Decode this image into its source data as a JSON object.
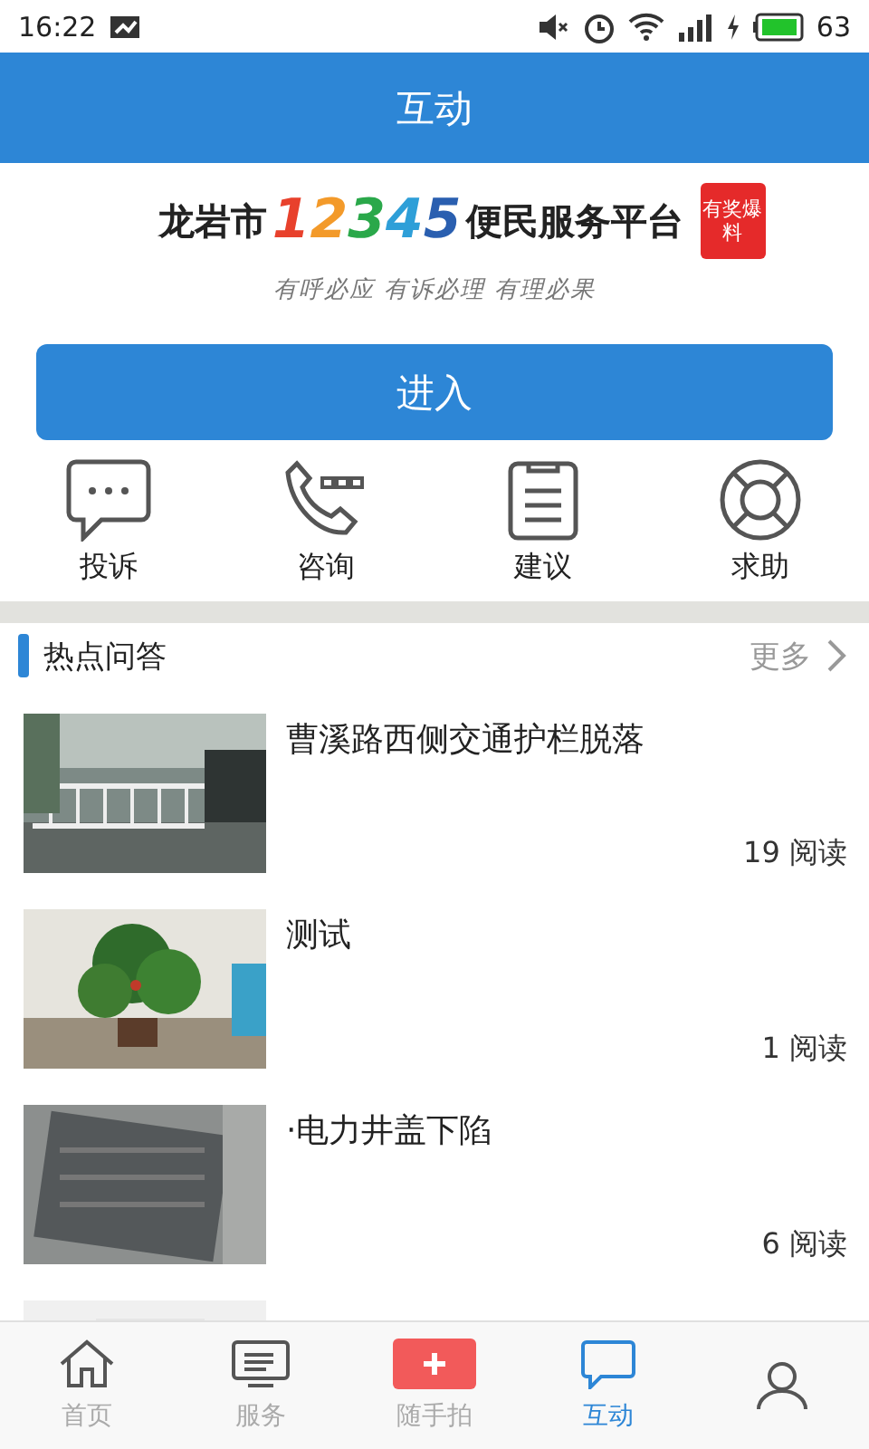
{
  "status_bar": {
    "time": "16:22",
    "battery": "63"
  },
  "header": {
    "title": "互动"
  },
  "banner": {
    "city": "龙岩市",
    "digits": [
      {
        "text": "1",
        "color": "#e8412c"
      },
      {
        "text": "2",
        "color": "#f39a2a"
      },
      {
        "text": "3",
        "color": "#2aa84a"
      },
      {
        "text": "4",
        "color": "#2e9fd8"
      },
      {
        "text": "5",
        "color": "#2a5fb0"
      }
    ],
    "platform": "便民服务平台",
    "badge": "有奖爆料",
    "slogan": "有呼必应 有诉必理 有理必果"
  },
  "enter_button": "进入",
  "actions": [
    {
      "kind": "chat",
      "label": "投诉"
    },
    {
      "kind": "phone",
      "label": "咨询"
    },
    {
      "kind": "note",
      "label": "建议"
    },
    {
      "kind": "lifebuoy",
      "label": "求助"
    }
  ],
  "section": {
    "title": "热点问答",
    "more": "更多"
  },
  "news": [
    {
      "title": "曹溪路西侧交通护栏脱落",
      "reads": "19 阅读",
      "kind": "fence"
    },
    {
      "title": "测试",
      "reads": "1 阅读",
      "kind": "plant"
    },
    {
      "title": "·电力井盖下陷",
      "reads": "6 阅读",
      "kind": "cover"
    },
    {
      "kind": "blank"
    }
  ],
  "tabs": [
    {
      "kind": "home",
      "label": "首页",
      "selected": false
    },
    {
      "kind": "service",
      "label": "服务",
      "selected": false
    },
    {
      "kind": "plus",
      "label": "随手拍",
      "selected": false
    },
    {
      "kind": "chat",
      "label": "互动",
      "selected": true
    },
    {
      "kind": "person",
      "selected": false
    }
  ]
}
